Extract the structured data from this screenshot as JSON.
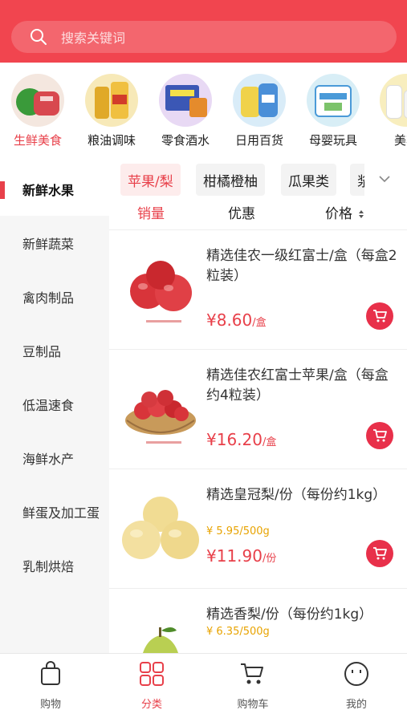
{
  "search": {
    "placeholder": "搜索关键词"
  },
  "categories": [
    {
      "label": "生鲜美食",
      "active": true
    },
    {
      "label": "粮油调味"
    },
    {
      "label": "零食酒水"
    },
    {
      "label": "日用百货"
    },
    {
      "label": "母婴玩具"
    },
    {
      "label": "美妆"
    }
  ],
  "sidebar": {
    "items": [
      {
        "label": "新鲜水果",
        "active": true
      },
      {
        "label": "新鲜蔬菜"
      },
      {
        "label": "禽肉制品"
      },
      {
        "label": "豆制品"
      },
      {
        "label": "低温速食"
      },
      {
        "label": "海鲜水产"
      },
      {
        "label": "鲜蛋及加工蛋"
      },
      {
        "label": "乳制烘焙"
      }
    ]
  },
  "chips": [
    {
      "label": "苹果/梨",
      "active": true
    },
    {
      "label": "柑橘橙柚"
    },
    {
      "label": "瓜果类"
    },
    {
      "label": "浆"
    }
  ],
  "sort": {
    "sales": "销量",
    "promo": "优惠",
    "price": "价格"
  },
  "products": [
    {
      "name": "精选佳农一级红富士/盒（每盒2粒装）",
      "price": "¥8.60",
      "per": "/盒",
      "unit_price": "",
      "image": "red-apples-pair"
    },
    {
      "name": "精选佳农红富士苹果/盒（每盒约4粒装）",
      "price": "¥16.20",
      "per": "/盒",
      "unit_price": "",
      "image": "red-apples-basket"
    },
    {
      "name": "精选皇冠梨/份（每份约1kg）",
      "price": "¥11.90",
      "per": "/份",
      "unit_price": "¥ 5.95/500g",
      "image": "crown-pears"
    },
    {
      "name": "精选香梨/份（每份约1kg）",
      "price": "",
      "per": "",
      "unit_price": "¥ 6.35/500g",
      "image": "green-pear"
    }
  ],
  "tabbar": [
    {
      "label": "购物",
      "icon": "bag-icon"
    },
    {
      "label": "分类",
      "icon": "grid-icon",
      "active": true
    },
    {
      "label": "购物车",
      "icon": "cart-icon"
    },
    {
      "label": "我的",
      "icon": "smiley-icon"
    }
  ],
  "colors": {
    "accent": "#e8404a",
    "header": "#f1454f",
    "unit_price": "#e8a300"
  }
}
